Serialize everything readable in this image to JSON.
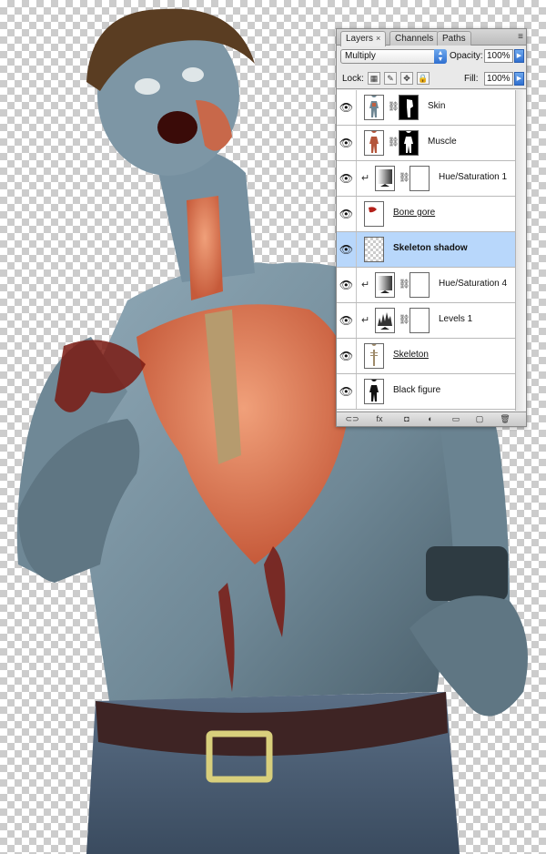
{
  "panel": {
    "tabs": [
      {
        "label": "Layers",
        "active": true,
        "close": "×"
      },
      {
        "label": "Channels",
        "active": false
      },
      {
        "label": "Paths",
        "active": false
      }
    ],
    "menu_glyph": "≡",
    "blend_mode": "Multiply",
    "opacity_label": "Opacity:",
    "opacity_value": "100%",
    "lock_label": "Lock:",
    "fill_label": "Fill:",
    "fill_value": "100%",
    "selected_layer": "Skeleton shadow",
    "layers": [
      {
        "name": "Skin",
        "visible": true,
        "clipped": false,
        "thumb": "skin",
        "mask": "skin-mask",
        "style": ""
      },
      {
        "name": "Muscle",
        "visible": true,
        "clipped": false,
        "thumb": "muscle",
        "mask": "muscle-mask",
        "style": ""
      },
      {
        "name": "Hue/Saturation 1",
        "visible": true,
        "clipped": true,
        "thumb": "adjustment",
        "mask": "white",
        "style": ""
      },
      {
        "name": "Bone gore",
        "visible": true,
        "clipped": false,
        "thumb": "gore",
        "mask": "",
        "style": "underline"
      },
      {
        "name": "Skeleton shadow",
        "visible": true,
        "clipped": false,
        "thumb": "empty",
        "mask": "",
        "style": "bold"
      },
      {
        "name": "Hue/Saturation 4",
        "visible": true,
        "clipped": true,
        "thumb": "adjustment",
        "mask": "white",
        "style": ""
      },
      {
        "name": "Levels 1",
        "visible": true,
        "clipped": true,
        "thumb": "levels",
        "mask": "white",
        "style": ""
      },
      {
        "name": "Skeleton",
        "visible": true,
        "clipped": false,
        "thumb": "skeleton",
        "mask": "",
        "style": "underline"
      },
      {
        "name": "Black figure",
        "visible": true,
        "clipped": false,
        "thumb": "figure",
        "mask": "",
        "style": ""
      }
    ],
    "bottom_buttons": [
      {
        "name": "link-layers-button",
        "glyph": "⊂⊃"
      },
      {
        "name": "layer-style-button",
        "glyph": "fx"
      },
      {
        "name": "add-mask-button",
        "glyph": "◘"
      },
      {
        "name": "adjustment-layer-button",
        "glyph": "◐"
      },
      {
        "name": "new-group-button",
        "glyph": "▭"
      },
      {
        "name": "new-layer-button",
        "glyph": "▢"
      },
      {
        "name": "delete-layer-button",
        "glyph": "🗑"
      }
    ]
  },
  "colors": {
    "selection": "#b8d7fb",
    "skin": "#7d95a3",
    "muscle": "#d9714f",
    "blood": "#7a1a12",
    "hair": "#5a3d22",
    "denim": "#4c6078",
    "belt": "#3e2424",
    "buckle": "#d8cf7c"
  }
}
